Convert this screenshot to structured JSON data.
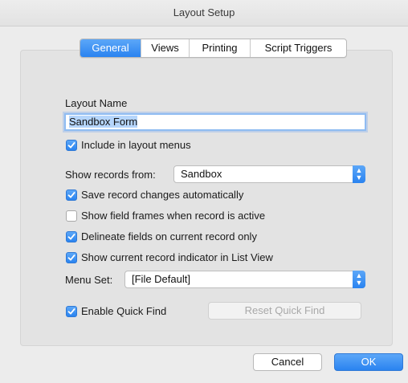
{
  "window": {
    "title": "Layout Setup"
  },
  "tabs": [
    "General",
    "Views",
    "Printing",
    "Script Triggers"
  ],
  "layout_name": {
    "label": "Layout Name",
    "value": "Sandbox Form"
  },
  "include_in_menus": {
    "label": "Include in layout menus",
    "checked": true
  },
  "show_records": {
    "label": "Show records from:",
    "value": "Sandbox"
  },
  "options": [
    {
      "label": "Save record changes automatically",
      "checked": true
    },
    {
      "label": "Show field frames when record is active",
      "checked": false
    },
    {
      "label": "Delineate fields on current record only",
      "checked": true
    },
    {
      "label": "Show current record indicator in List View",
      "checked": true
    }
  ],
  "menu_set": {
    "label": "Menu Set:",
    "value": "[File Default]"
  },
  "quick_find": {
    "label": "Enable Quick Find",
    "checked": true,
    "reset_label": "Reset Quick Find"
  },
  "buttons": {
    "cancel": "Cancel",
    "ok": "OK"
  },
  "colors": {
    "accent": "#2a83f0",
    "panel": "#e3e3e3",
    "window": "#ececec"
  }
}
